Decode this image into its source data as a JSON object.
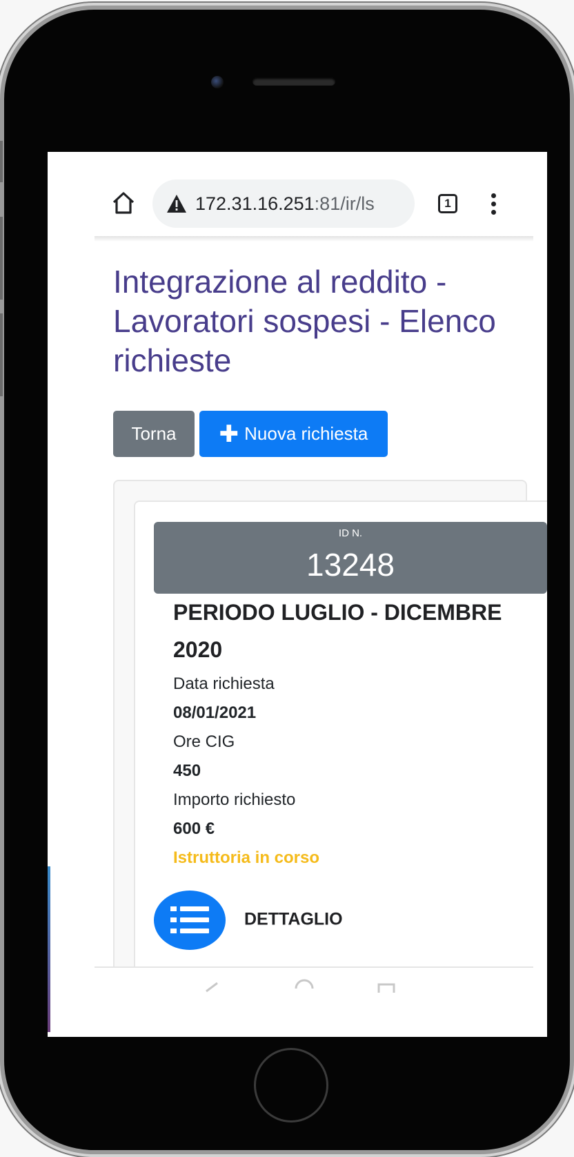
{
  "browser": {
    "url_host": "172.31.16.251",
    "url_path": ":81/ir/ls",
    "tab_count": "1",
    "icons": [
      "home-icon",
      "warning-icon",
      "tabs-icon",
      "more-vert-icon"
    ]
  },
  "page": {
    "title": "Integrazione al reddito - Lavoratori sospesi - Elenco richieste"
  },
  "buttons": {
    "back_label": "Torna",
    "new_label": "Nuova richiesta",
    "new_icon": "plus-icon"
  },
  "request": {
    "id_label": "ID N.",
    "id_value": "13248",
    "period": "PERIODO LUGLIO - DICEMBRE 2020",
    "date_label": "Data richiesta",
    "date_value": "08/01/2021",
    "hours_label": "Ore CIG",
    "hours_value": "450",
    "amount_label": "Importo richiesto",
    "amount_value": "600 €",
    "status": "Istruttoria in corso",
    "status_color": "#f5bb1b",
    "detail_label": "DETTAGLIO",
    "detail_icon": "list-icon"
  },
  "colors": {
    "title": "#483d8b",
    "primary": "#0d7bf5",
    "secondary": "#6c757d"
  }
}
